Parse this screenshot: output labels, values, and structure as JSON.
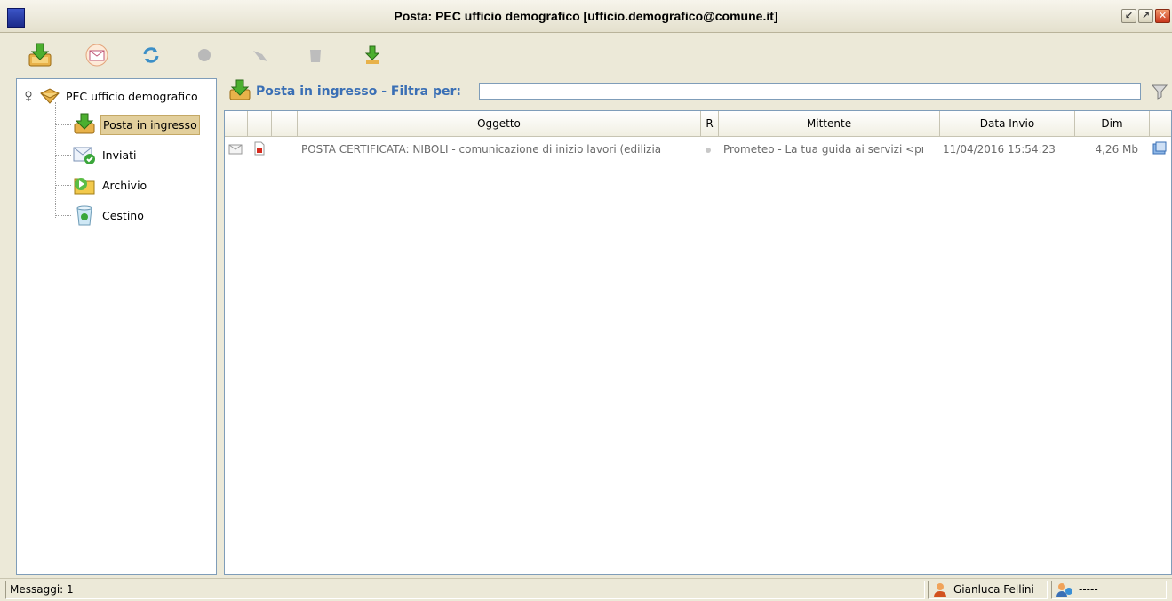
{
  "window": {
    "title": "Posta: PEC ufficio demografico [ufficio.demografico@comune.it]",
    "controls": [
      "minimize",
      "maximize",
      "close"
    ]
  },
  "toolbar": {
    "buttons": [
      {
        "icon": "receive-mail-icon",
        "enabled": true
      },
      {
        "icon": "new-mail-icon",
        "enabled": true
      },
      {
        "icon": "refresh-icon",
        "enabled": true
      },
      {
        "icon": "delete-icon",
        "enabled": false
      },
      {
        "icon": "move-icon",
        "enabled": false
      },
      {
        "icon": "trash-icon",
        "enabled": false
      },
      {
        "icon": "download-icon",
        "enabled": true
      }
    ]
  },
  "tree": {
    "root": "PEC ufficio demografico",
    "folders": [
      {
        "label": "Posta in ingresso",
        "icon": "inbox-icon",
        "selected": true
      },
      {
        "label": "Inviati",
        "icon": "sent-icon",
        "selected": false
      },
      {
        "label": "Archivio",
        "icon": "archive-icon",
        "selected": false
      },
      {
        "label": "Cestino",
        "icon": "recycle-bin-icon",
        "selected": false
      }
    ]
  },
  "filter": {
    "title": "Posta in ingresso - Filtra per:",
    "value": ""
  },
  "grid": {
    "columns": [
      "",
      "",
      "",
      "Oggetto",
      "R",
      "Mittente",
      "Data Invio",
      "Dim"
    ],
    "rows": [
      {
        "oggetto": "POSTA CERTIFICATA: NIBOLI - comunicazione di inizio lavori (edilizia",
        "mittente": "Prometeo - La tua guida ai servizi <pı",
        "data_invio": "11/04/2016 15:54:23",
        "dim": "4,26 Mb"
      }
    ]
  },
  "status": {
    "messages": "Messaggi: 1",
    "user": "Gianluca Fellini",
    "info": "-----"
  },
  "colors": {
    "accent_blue": "#3a6fb5",
    "selection": "#e2cf9c",
    "window_bg": "#ece9d8"
  }
}
